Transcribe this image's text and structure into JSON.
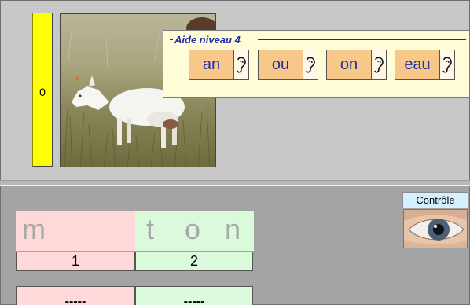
{
  "score": {
    "value": "0",
    "color": "#ffff00"
  },
  "help": {
    "title": "Aide niveau 4",
    "buttons": [
      {
        "label": "an",
        "icon": "ear-icon"
      },
      {
        "label": "ou",
        "icon": "ear-icon"
      },
      {
        "label": "on",
        "icon": "ear-icon"
      },
      {
        "label": "eau",
        "icon": "ear-icon"
      }
    ],
    "label_color": "#1a2fa8",
    "button_color": "#f8c88a"
  },
  "controle": {
    "label": "Contrôle",
    "icon": "eye-icon"
  },
  "word": {
    "syllables": [
      {
        "letters": [
          "m"
        ],
        "number": "1",
        "answer": "-----",
        "color": "#ffd9da"
      },
      {
        "letters": [
          "t",
          "o",
          "n"
        ],
        "number": "2",
        "answer": "-----",
        "color": "#dafadb"
      }
    ]
  },
  "picture": {
    "subject": "goat-photo"
  }
}
